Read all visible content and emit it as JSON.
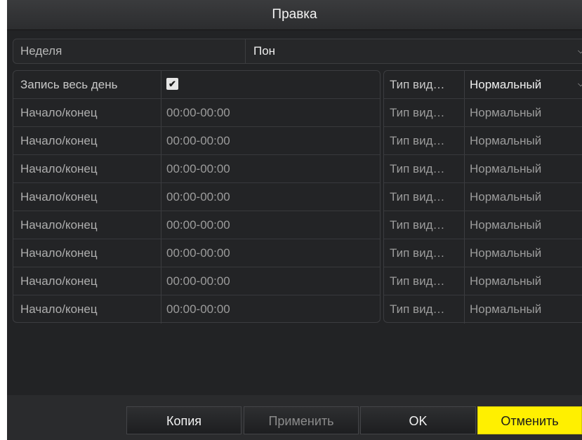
{
  "dialog": {
    "title": "Правка"
  },
  "week_field": {
    "label": "Неделя",
    "value": "Пон",
    "arrow_icon": "chevron-down-icon"
  },
  "all_day_row": {
    "label": "Запись весь день",
    "checked": true,
    "checkbox_glyph": "✔",
    "type_label": "Тип вид…",
    "type_value": "Нормальный"
  },
  "schedule_rows": [
    {
      "label": "Начало/конец",
      "time": "00:00-00:00",
      "type_label": "Тип вид…",
      "type_value": "Нормальный"
    },
    {
      "label": "Начало/конец",
      "time": "00:00-00:00",
      "type_label": "Тип вид…",
      "type_value": "Нормальный"
    },
    {
      "label": "Начало/конец",
      "time": "00:00-00:00",
      "type_label": "Тип вид…",
      "type_value": "Нормальный"
    },
    {
      "label": "Начало/конец",
      "time": "00:00-00:00",
      "type_label": "Тип вид…",
      "type_value": "Нормальный"
    },
    {
      "label": "Начало/конец",
      "time": "00:00-00:00",
      "type_label": "Тип вид…",
      "type_value": "Нормальный"
    },
    {
      "label": "Начало/конец",
      "time": "00:00-00:00",
      "type_label": "Тип вид…",
      "type_value": "Нормальный"
    },
    {
      "label": "Начало/конец",
      "time": "00:00-00:00",
      "type_label": "Тип вид…",
      "type_value": "Нормальный"
    },
    {
      "label": "Начало/конец",
      "time": "00:00-00:00",
      "type_label": "Тип вид…",
      "type_value": "Нормальный"
    }
  ],
  "footer": {
    "copy_label": "Копия",
    "apply_label": "Применить",
    "ok_label": "OK",
    "cancel_label": "Отменить"
  },
  "colors": {
    "background": "#222325",
    "accent_button": "#fff000"
  }
}
